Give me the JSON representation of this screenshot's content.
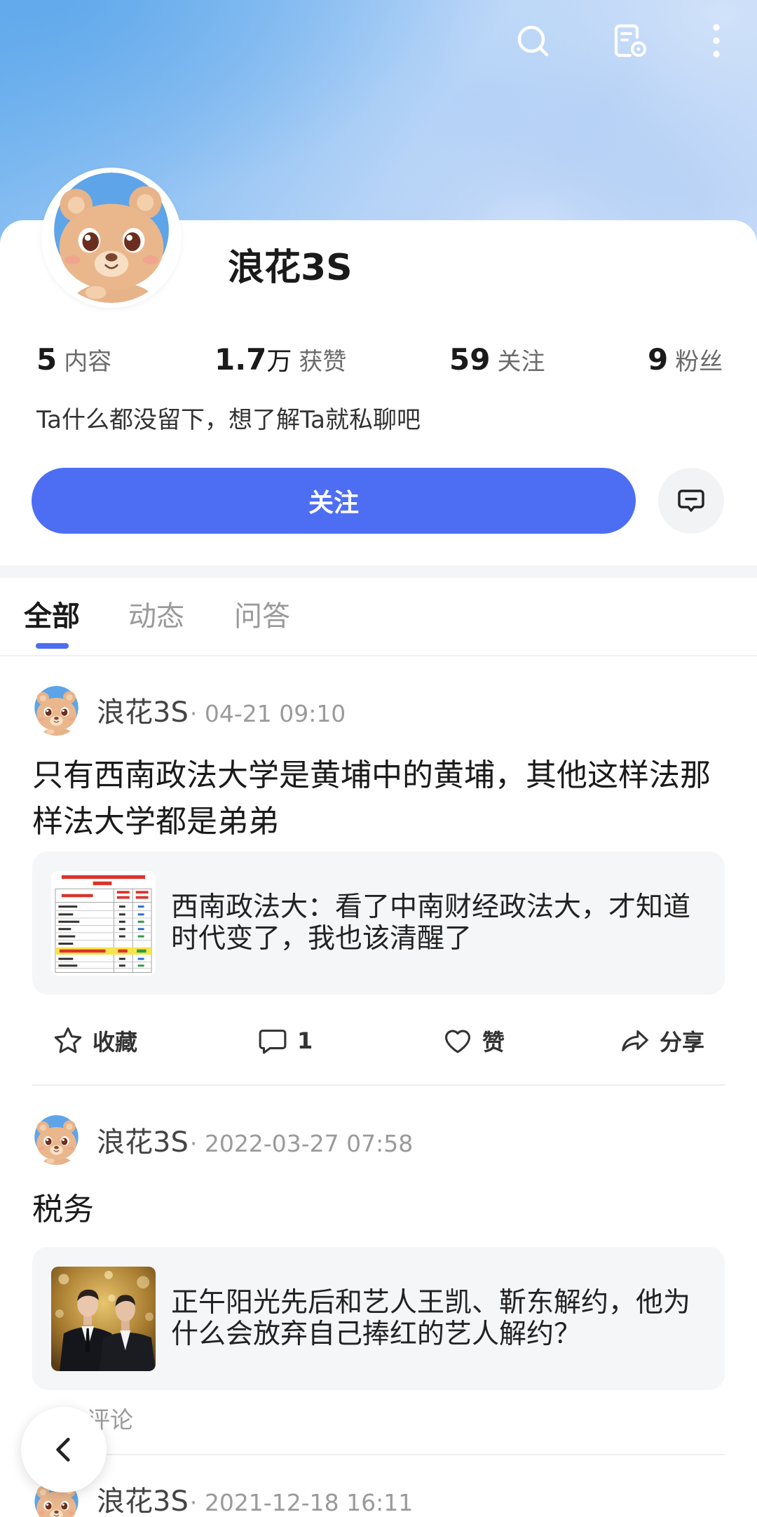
{
  "colors": {
    "accent": "#4d6ef2",
    "text_primary": "#1a1a1a",
    "text_secondary": "#9a9a9a",
    "quote_background": "#f5f6f8",
    "banner_blue": "#72b4ef"
  },
  "toolbar": {
    "icons": [
      "search-icon",
      "document-settings-icon",
      "more-vertical-icon"
    ]
  },
  "profile": {
    "name": "浪花3S",
    "stats": [
      {
        "value": "5",
        "unit": "",
        "label": "内容"
      },
      {
        "value": "1.7",
        "unit": "万",
        "label": "获赞"
      },
      {
        "value": "59",
        "unit": "",
        "label": "关注"
      },
      {
        "value": "9",
        "unit": "",
        "label": "粉丝"
      }
    ],
    "bio": "Ta什么都没留下，想了解Ta就私聊吧",
    "follow_label": "关注",
    "message_icon": "chat-bubble-icon"
  },
  "tabs": [
    {
      "label": "全部",
      "active": true
    },
    {
      "label": "动态",
      "active": false
    },
    {
      "label": "问答",
      "active": false
    }
  ],
  "posts": [
    {
      "author": "浪花3S",
      "time": "· 04-21 09:10",
      "text": "只有西南政法大学是黄埔中的黄埔，其他这样法那样法大学都是弟弟",
      "quote": {
        "title": "西南政法大：看了中南财经政法大，才知道时代变了，我也该清醒了"
      },
      "actions": {
        "favorite": "收藏",
        "comment_count": "1",
        "like": "赞",
        "share": "分享"
      }
    },
    {
      "author": "浪花3S",
      "time": "· 2022-03-27 07:58",
      "text": "税务",
      "quote": {
        "title": "正午阳光先后和艺人王凯、靳东解约，他为什么会放弃自己捧红的艺人解约？"
      },
      "comment_link": "评论"
    },
    {
      "author": "浪花3S",
      "time": "· 2021-12-18 16:11"
    }
  ],
  "navigation": {
    "back_icon": "chevron-left-icon"
  }
}
